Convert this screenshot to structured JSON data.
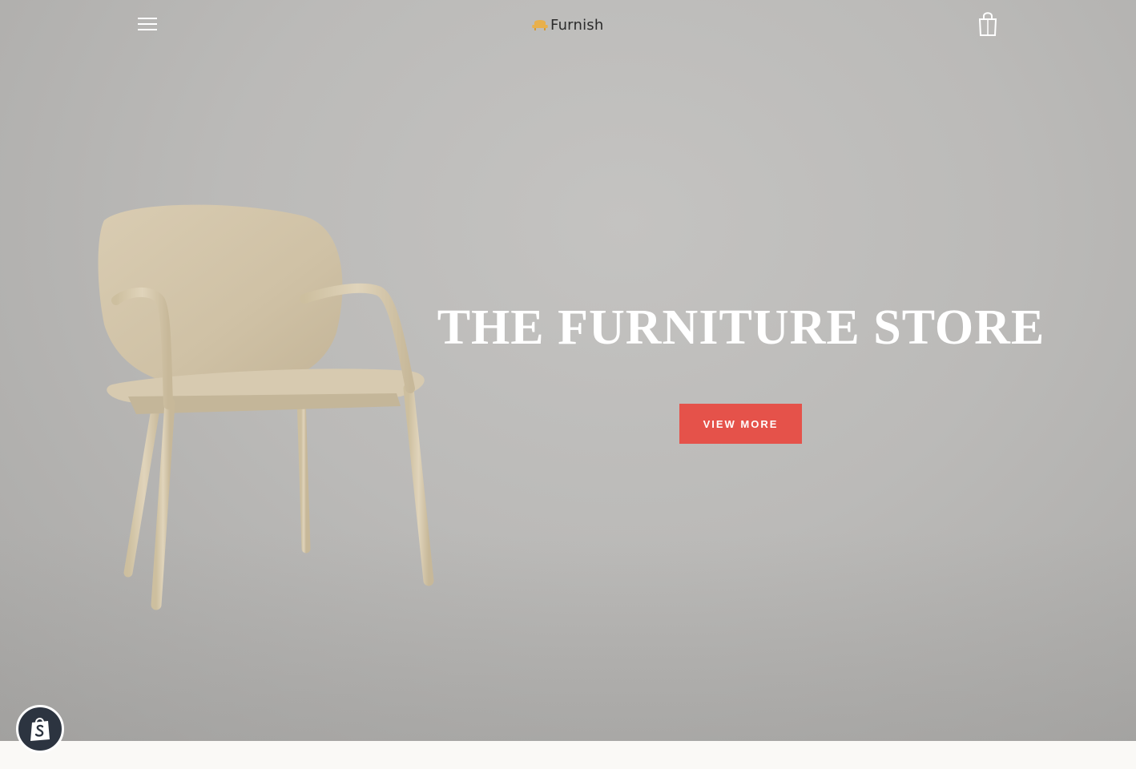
{
  "header": {
    "menu_icon": "hamburger-menu-icon",
    "logo_text": "Furnish",
    "logo_icon": "sofa-logo-icon",
    "logo_color": "#e8b04c",
    "cart_icon": "shopping-bag-icon"
  },
  "hero": {
    "title": "THE FURNITURE STORE",
    "cta_label": "VIEW MORE",
    "cta_color": "#e5524a",
    "image": "wooden-chair-image"
  },
  "badge": {
    "icon": "shopify-bag-icon"
  }
}
